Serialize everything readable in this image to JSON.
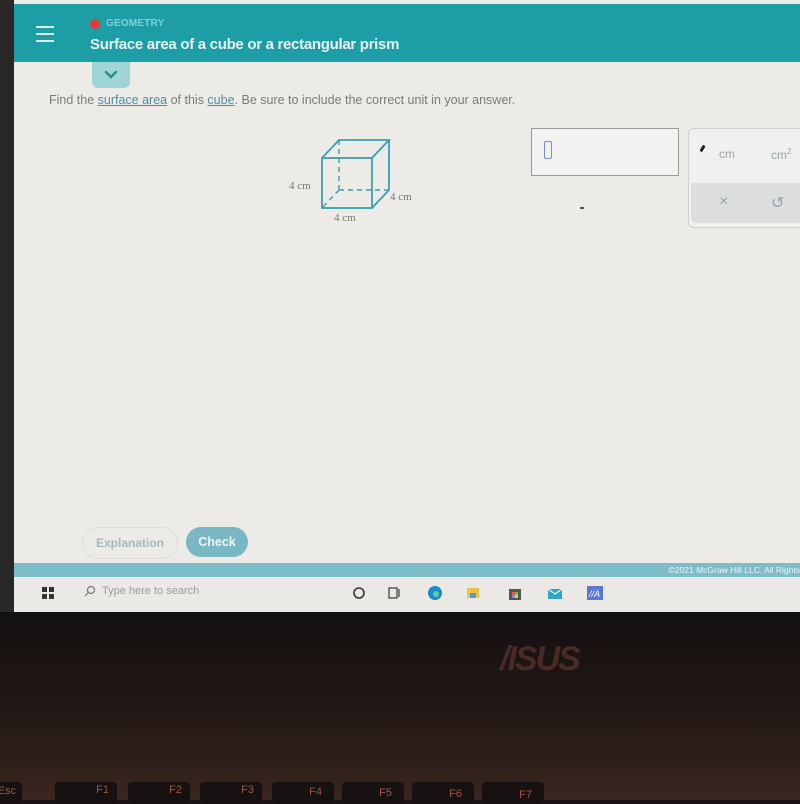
{
  "header": {
    "topic": "GEOMETRY",
    "title": "Surface area of a cube or a rectangular prism",
    "menu_icon": "hamburger-menu-icon",
    "topic_dot_color": "#e53935",
    "brand_color": "#1d9ea6"
  },
  "question": {
    "prefix": "Find the ",
    "link1": "surface area",
    "middle": " of this ",
    "link2": "cube",
    "suffix": ". Be sure to include the correct unit in your answer."
  },
  "figure": {
    "shape": "cube",
    "height_label": "4 cm",
    "depth_label": "4 cm",
    "width_label": "4 cm"
  },
  "answer": {
    "value": ""
  },
  "unit_panel": {
    "units": [
      {
        "label": "cm",
        "sup": ""
      },
      {
        "label": "cm",
        "sup": "2"
      }
    ],
    "clear_label": "×",
    "undo_label": "↺"
  },
  "footer": {
    "explanation_label": "Explanation",
    "check_label": "Check",
    "copyright": "©2021 McGraw Hill LLC. All Rights"
  },
  "taskbar": {
    "search_placeholder": "Type here to search",
    "icons": [
      "windows-start-icon",
      "cortana-icon",
      "task-view-icon",
      "edge-icon",
      "file-explorer-icon",
      "store-icon",
      "mail-icon",
      "app-icon"
    ]
  },
  "laptop": {
    "brand": "/ISUS",
    "keys": [
      "Esc",
      "F1",
      "F2",
      "F3",
      "F4",
      "F5",
      "F6",
      "F7"
    ]
  }
}
